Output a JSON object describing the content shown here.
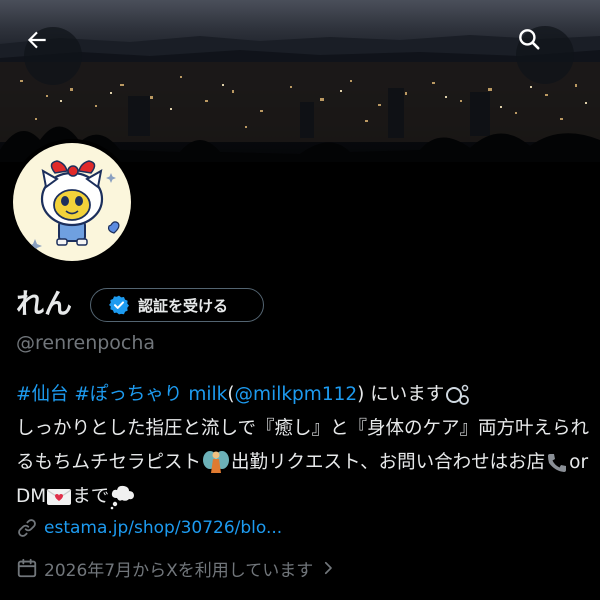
{
  "header": {
    "back_icon": "arrow-left-icon",
    "search_icon": "search-icon"
  },
  "profile": {
    "name": "れん",
    "verify_label": "認証を受ける",
    "handle": "@renrenpocha"
  },
  "bio": {
    "hashtag1": "#仙台",
    "hashtag2": "#ぽっちゃり",
    "milk_word": "milk",
    "paren_open": "(",
    "mention": "@milkpm112",
    "text1": ") にいます",
    "text2": "しっかりとした指圧と流しで『癒し』と『身体のケア』両方叶えられるもちムチセラピスト",
    "text3": "出勤リクエスト、お問い合わせはお店",
    "text4": "or DM",
    "text5": "まで"
  },
  "meta": {
    "url": "estama.jp/shop/30726/blo...",
    "joined": "2026年7月からXを利用しています",
    "accent_color": "#1d9bf0",
    "muted_color": "#71767b"
  }
}
